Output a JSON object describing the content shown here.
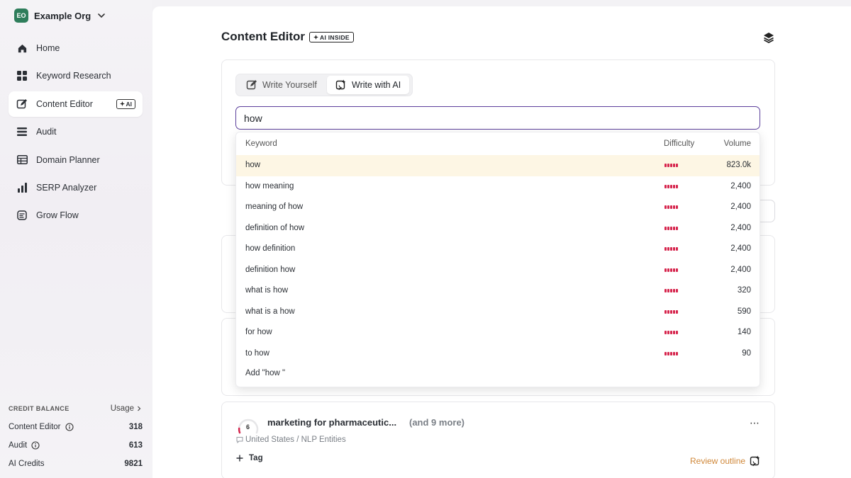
{
  "org": {
    "initials": "EO",
    "name": "Example Org"
  },
  "nav": {
    "items": [
      {
        "label": "Home",
        "icon": "home-icon"
      },
      {
        "label": "Keyword Research",
        "icon": "grid-icon"
      },
      {
        "label": "Content Editor",
        "icon": "edit-icon",
        "badge": "AI"
      },
      {
        "label": "Audit",
        "icon": "list-icon"
      },
      {
        "label": "Domain Planner",
        "icon": "table-icon"
      },
      {
        "label": "SERP Analyzer",
        "icon": "bar-chart-icon"
      },
      {
        "label": "Grow Flow",
        "icon": "flow-icon"
      }
    ]
  },
  "credits": {
    "title": "CREDIT BALANCE",
    "usage_label": "Usage",
    "rows": [
      {
        "label": "Content Editor",
        "value": "318"
      },
      {
        "label": "Audit",
        "value": "613"
      },
      {
        "label": "AI Credits",
        "value": "9821"
      }
    ]
  },
  "header": {
    "title": "Content Editor",
    "badge": "AI INSIDE"
  },
  "mode_toggle": {
    "write_yourself": "Write Yourself",
    "write_with_ai": "Write with AI"
  },
  "search": {
    "value": "how "
  },
  "dropdown": {
    "columns": {
      "keyword": "Keyword",
      "difficulty": "Difficulty",
      "volume": "Volume"
    },
    "rows": [
      {
        "keyword": "how",
        "volume": "823.0k"
      },
      {
        "keyword": "how meaning",
        "volume": "2,400"
      },
      {
        "keyword": "meaning of how",
        "volume": "2,400"
      },
      {
        "keyword": "definition of how",
        "volume": "2,400"
      },
      {
        "keyword": "how definition",
        "volume": "2,400"
      },
      {
        "keyword": "definition how",
        "volume": "2,400"
      },
      {
        "keyword": "what is how",
        "volume": "320"
      },
      {
        "keyword": "what is a how",
        "volume": "590"
      },
      {
        "keyword": "for how",
        "volume": "140"
      },
      {
        "keyword": "to how",
        "volume": "90"
      }
    ],
    "add_label": "Add \"how \""
  },
  "document": {
    "score": "6",
    "title": "marketing for pharmaceutic...",
    "more": "(and 9 more)",
    "subtitle": "United States / NLP Entities",
    "tag_label": "Tag",
    "review_label": "Review outline"
  },
  "colors": {
    "accent": "#5b3f9b",
    "difficulty": "#d6254d",
    "highlight": "#fdf6e4",
    "review": "#d0883a"
  }
}
